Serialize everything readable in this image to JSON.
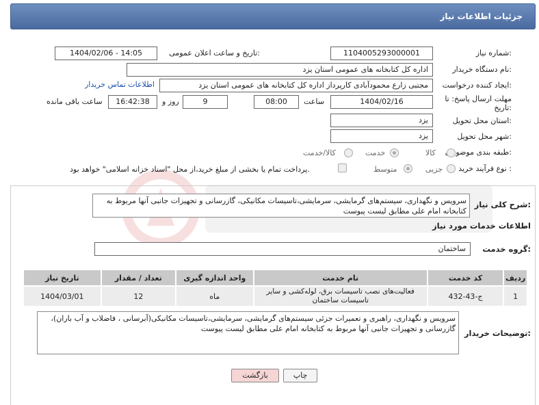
{
  "header": {
    "title": "جزئیات اطلاعات نیاز"
  },
  "form": {
    "need_number_label": "شماره نیاز:",
    "need_number": "1104005293000001",
    "announce_label": "تاریخ و ساعت اعلان عمومی:",
    "announce_value": "1404/02/06 - 14:05",
    "buyer_org_label": "نام دستگاه خریدار:",
    "buyer_org": "اداره کل کتابخانه های عمومی استان یزد",
    "creator_label": "ایجاد کننده درخواست:",
    "creator": "مجتبی زارع محمودآبادی کارپرداز اداره کل کتابخانه های عمومی استان یزد",
    "contact_link": "اطلاعات تماس خریدار",
    "deadline_label_1": "مهلت ارسال پاسخ: تا",
    "deadline_label_2": "تاریخ:",
    "deadline_date": "1404/02/16",
    "time_label": "ساعت",
    "deadline_time": "08:00",
    "days_value": "9",
    "days_label": "روز و",
    "remaining_time": "16:42:38",
    "remaining_label": "ساعت باقی مانده",
    "province_label": "استان محل تحویل:",
    "province": "یزد",
    "city_label": "شهر محل تحویل:",
    "city": "یزد",
    "category_label": "طبقه بندی موضوعی:",
    "category_options": [
      "کالا",
      "خدمت",
      "کالا/خدمت"
    ],
    "category_selected": "خدمت",
    "process_label": "نوع فرآیند خرید :",
    "process_options": [
      "جزیی",
      "متوسط"
    ],
    "process_selected": "متوسط",
    "payment_text": "پرداخت تمام یا بخشی از مبلغ خرید،از محل \"اسناد خزانه اسلامی\" خواهد بود."
  },
  "summary": {
    "label": "شرح کلی نیاز:",
    "text": "سرویس و نگهداری، سیستم‌های گرمایشی، سرمایشی،تاسیسات مکانیکی، گازرسانی و تجهیزات جانبی آنها مربوط به کتابخانه امام علی مطابق لیست پیوست"
  },
  "services": {
    "section_title": "اطلاعات خدمات مورد نیاز",
    "group_label": "گروه خدمت:",
    "group_value": "ساختمان",
    "columns": [
      "ردیف",
      "کد خدمت",
      "نام خدمت",
      "واحد اندازه گیری",
      "تعداد / مقدار",
      "تاریخ نیاز"
    ],
    "rows": [
      [
        "1",
        "ج-43-432",
        "فعالیت‌های نصب تاسیسات برق، لوله‌کشی و سایر تاسیسات ساختمان",
        "ماه",
        "12",
        "1404/03/01"
      ]
    ]
  },
  "notes": {
    "label": "توضیحات خریدار:",
    "text": "سرویس و نگهداری، راهبری و تعمیرات جزئی سیستم‌های گرمایشی، سرمایشی،تاسیسات مکانیکی(آبرسانی ، فاضلاب و آب باران)، گازرسانی و تجهیزات جانبی آنها مربوط به کتابخانه امام علی مطابق لیست پیوست"
  },
  "buttons": {
    "print": "چاپ",
    "back": "بازگشت"
  },
  "colors": {
    "header": "#5577aa",
    "back_button": "#f6d5d5",
    "link": "#1a4fb0"
  }
}
